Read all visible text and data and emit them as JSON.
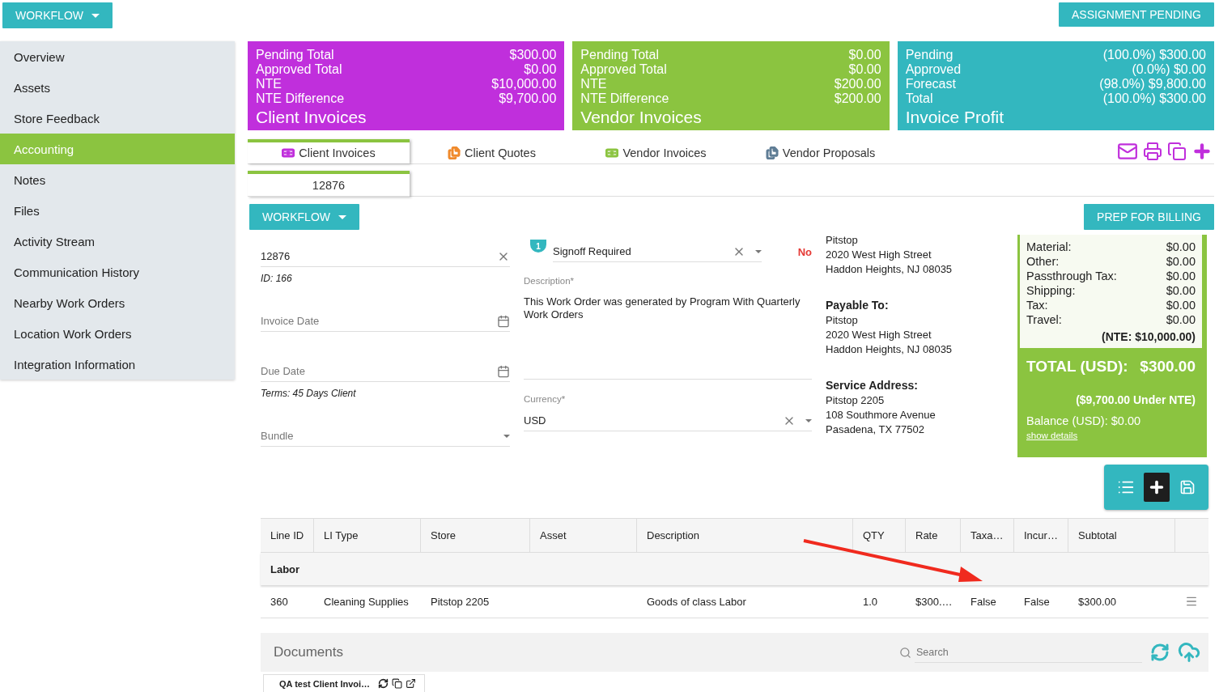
{
  "top_bar": {
    "workflow_button": "WORKFLOW",
    "status_button": "ASSIGNMENT PENDING"
  },
  "sidebar": {
    "items": [
      {
        "label": "Overview",
        "selected": false
      },
      {
        "label": "Assets",
        "selected": false
      },
      {
        "label": "Store Feedback",
        "selected": false
      },
      {
        "label": "Accounting",
        "selected": true
      },
      {
        "label": "Notes",
        "selected": false
      },
      {
        "label": "Files",
        "selected": false
      },
      {
        "label": "Activity Stream",
        "selected": false
      },
      {
        "label": "Communication History",
        "selected": false
      },
      {
        "label": "Nearby Work Orders",
        "selected": false
      },
      {
        "label": "Location Work Orders",
        "selected": false
      },
      {
        "label": "Integration Information",
        "selected": false
      }
    ]
  },
  "summary_cards": [
    {
      "title": "Client Invoices",
      "color": "#c02fdc",
      "rows": [
        {
          "label": "Pending Total",
          "value": "$300.00"
        },
        {
          "label": "Approved Total",
          "value": "$0.00"
        },
        {
          "label": "NTE",
          "value": "$10,000.00"
        },
        {
          "label": "NTE Difference",
          "value": "$9,700.00"
        }
      ]
    },
    {
      "title": "Vendor Invoices",
      "color": "#8bc440",
      "rows": [
        {
          "label": "Pending Total",
          "value": "$0.00"
        },
        {
          "label": "Approved Total",
          "value": "$0.00"
        },
        {
          "label": "NTE",
          "value": "$200.00"
        },
        {
          "label": "NTE Difference",
          "value": "$200.00"
        }
      ]
    },
    {
      "title": "Invoice Profit",
      "color": "#33b7bf",
      "rows": [
        {
          "label": "Pending",
          "value": "(100.0%) $300.00"
        },
        {
          "label": "Approved",
          "value": "(0.0%) $0.00"
        },
        {
          "label": "Forecast",
          "value": "(98.0%) $9,800.00"
        },
        {
          "label": "Total",
          "value": "(100.0%) $300.00"
        }
      ]
    }
  ],
  "tabs": [
    {
      "label": "Client Invoices",
      "kind": "money",
      "color": "#c02fdc",
      "selected": true
    },
    {
      "label": "Client Quotes",
      "kind": "document",
      "color": "#f08a2c",
      "selected": false
    },
    {
      "label": "Vendor Invoices",
      "kind": "money",
      "color": "#8bc440",
      "selected": false
    },
    {
      "label": "Vendor Proposals",
      "kind": "document",
      "color": "#5f7d95",
      "selected": false
    }
  ],
  "invoice_tabs": [
    {
      "label": "12876",
      "selected": true
    }
  ],
  "workflow_button": "WORKFLOW",
  "prep_button": "PREP FOR BILLING",
  "left_fields": [
    {
      "kind": "text",
      "value": "12876",
      "note": "ID: 166"
    },
    {
      "kind": "date",
      "placeholder": "Invoice Date"
    },
    {
      "kind": "date",
      "placeholder": "Due Date",
      "note": "Terms: 45 Days Client"
    },
    {
      "kind": "select",
      "placeholder": "Bundle"
    }
  ],
  "signoff": {
    "badge": "1",
    "value": "Signoff Required",
    "status": "No"
  },
  "description": {
    "label": "Description*",
    "value": "This Work Order was generated by Program With Quarterly Work Orders"
  },
  "currency": {
    "label": "Currency*",
    "value": "USD"
  },
  "addresses": [
    {
      "lines": [
        "Pitstop",
        "2020 West High Street",
        "Haddon Heights, NJ 08035"
      ]
    },
    {
      "heading": "Payable To:",
      "lines": [
        "Pitstop",
        "2020 West High Street",
        "Haddon Heights, NJ 08035"
      ]
    },
    {
      "heading": "Service Address:",
      "lines": [
        "Pitstop 2205",
        "108 Southmore Avenue",
        "Pasadena, TX 77502"
      ]
    }
  ],
  "totals": {
    "rows": [
      {
        "label": "Material:",
        "value": "$0.00"
      },
      {
        "label": "Other:",
        "value": "$0.00"
      },
      {
        "label": "Passthrough Tax:",
        "value": "$0.00"
      },
      {
        "label": "Shipping:",
        "value": "$0.00"
      },
      {
        "label": "Tax:",
        "value": "$0.00"
      },
      {
        "label": "Travel:",
        "value": "$0.00"
      }
    ],
    "nte": "(NTE: $10,000.00)",
    "total_label": "TOTAL (USD):",
    "total_value": "$300.00",
    "under_nte": "($9,700.00 Under NTE)",
    "balance": "Balance (USD): $0.00",
    "details_link": "show details"
  },
  "table": {
    "columns": [
      "Line ID",
      "LI Type",
      "Store",
      "Asset",
      "Description",
      "QTY",
      "Rate",
      "Taxa…",
      "Incur…",
      "Subtotal"
    ],
    "group": "Labor",
    "rows": [
      [
        "360",
        "Cleaning Supplies",
        "Pitstop 2205",
        "",
        "Goods of class Labor",
        "1.0",
        "$300.…",
        "False",
        "False",
        "$300.00"
      ]
    ]
  },
  "documents": {
    "title": "Documents",
    "search_placeholder": "Search",
    "items": [
      {
        "name": "QA test Client Invoi…"
      }
    ]
  }
}
